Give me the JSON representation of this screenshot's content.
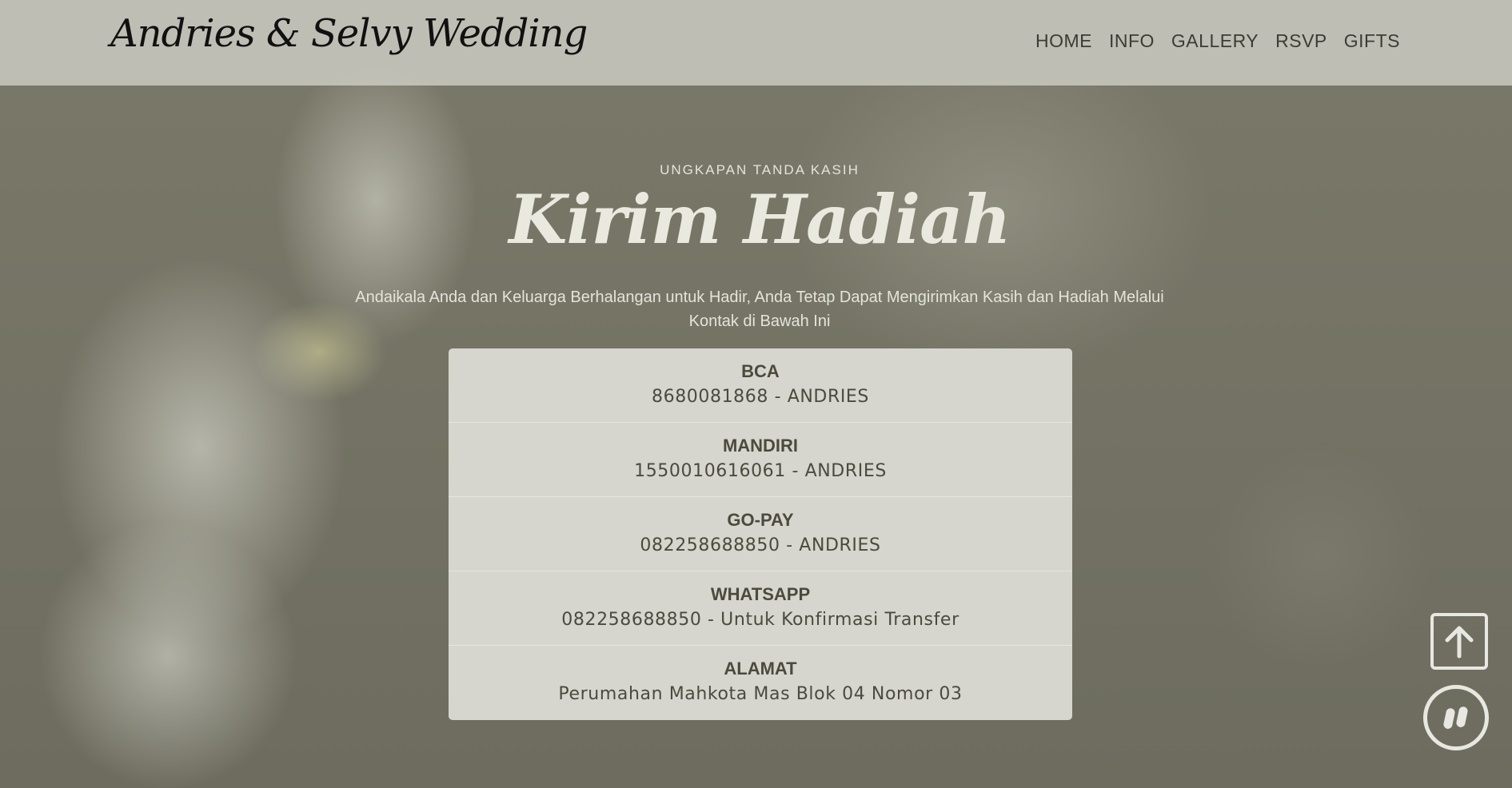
{
  "header": {
    "brand": "Andries & Selvy Wedding",
    "nav": [
      {
        "label": "HOME"
      },
      {
        "label": "INFO"
      },
      {
        "label": "GALLERY"
      },
      {
        "label": "RSVP"
      },
      {
        "label": "GIFTS"
      }
    ]
  },
  "gifts": {
    "eyebrow": "UNGKAPAN TANDA KASIH",
    "title": "Kirim Hadiah",
    "description": "Andaikala Anda dan Keluarga Berhalangan untuk Hadir, Anda Tetap Dapat Mengirimkan Kasih dan Hadiah Melalui Kontak di Bawah Ini",
    "accounts": [
      {
        "name": "BCA",
        "detail": "8680081868 - ANDRIES"
      },
      {
        "name": "MANDIRI",
        "detail": "1550010616061 - ANDRIES"
      },
      {
        "name": "GO-PAY",
        "detail": "082258688850 - ANDRIES"
      },
      {
        "name": "WHATSAPP",
        "detail": "082258688850 - Untuk Konfirmasi Transfer"
      },
      {
        "name": "ALAMAT",
        "detail": "Perumahan Mahkota Mas Blok 04 Nomor 03"
      }
    ]
  },
  "icons": {
    "back_to_top": "arrow-up-icon",
    "music_toggle": "pause-icon"
  },
  "colors": {
    "overlay": "#6f6e62",
    "card": "#d6d6cf",
    "text_dark": "#4b4a3c",
    "text_light": "#e9e9df"
  }
}
